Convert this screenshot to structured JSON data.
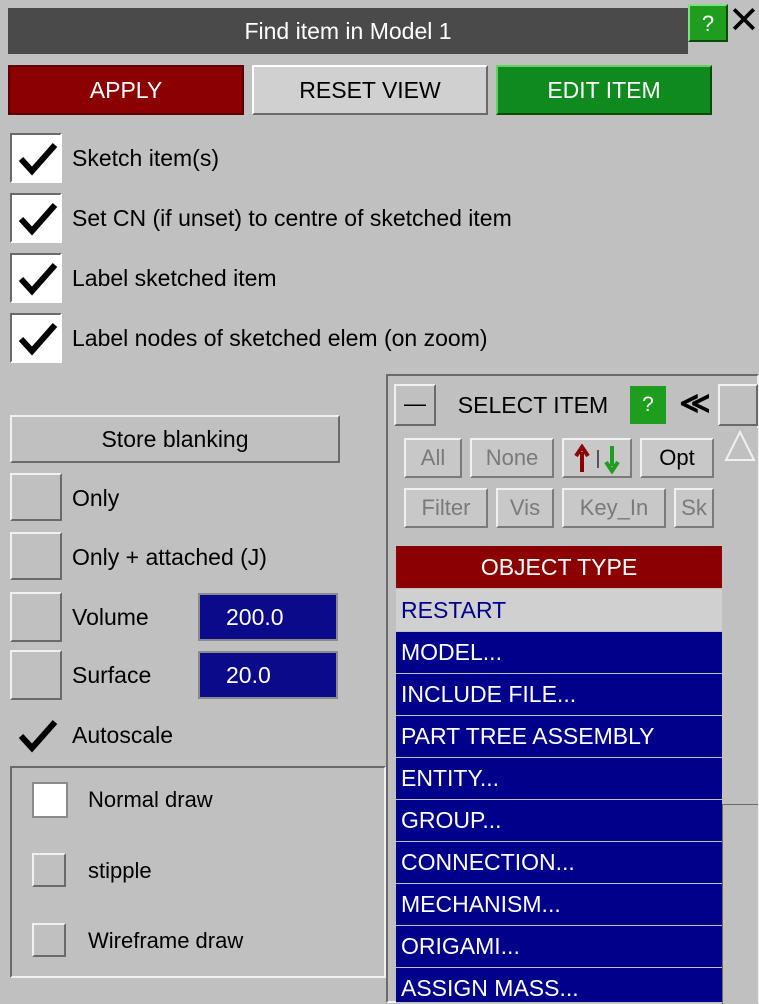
{
  "window": {
    "title": "Find item in Model 1",
    "help_label": "?",
    "close_label": "✕"
  },
  "actions": {
    "apply": "APPLY",
    "reset_view": "RESET VIEW",
    "edit_item": "EDIT ITEM"
  },
  "options": {
    "sketch": "Sketch item(s)",
    "set_cn": "Set CN (if unset) to centre of sketched item",
    "label_sketched": "Label sketched item",
    "label_nodes": "Label nodes of sketched elem (on zoom)"
  },
  "blanking": {
    "store_label": "Store blanking",
    "only": "Only",
    "only_attached": "Only + attached (J)",
    "volume_label": "Volume",
    "volume_value": "200.0",
    "surface_label": "Surface",
    "surface_value": "20.0",
    "autoscale": "Autoscale"
  },
  "draw": {
    "normal": "Normal draw",
    "stipple": "stipple",
    "wireframe": "Wireframe draw"
  },
  "select_panel": {
    "title": "SELECT ITEM",
    "help_label": "?",
    "collapse_label": "≪",
    "minimize_label": "—",
    "all": "All",
    "none": "None",
    "opt": "Opt",
    "filter": "Filter",
    "vis": "Vis",
    "key_in": "Key_In",
    "sk": "Sk",
    "header": "OBJECT TYPE",
    "restart": "RESTART",
    "items": [
      "MODEL...",
      "INCLUDE FILE...",
      "PART TREE ASSEMBLY",
      "ENTITY...",
      "GROUP...",
      "CONNECTION...",
      "MECHANISM...",
      "ORIGAMI...",
      "ASSIGN MASS..."
    ]
  },
  "colors": {
    "apply": "#8b0000",
    "edit": "#0f8a1e",
    "list_bg": "#00008b",
    "panel_bg": "#c0c0c0"
  }
}
